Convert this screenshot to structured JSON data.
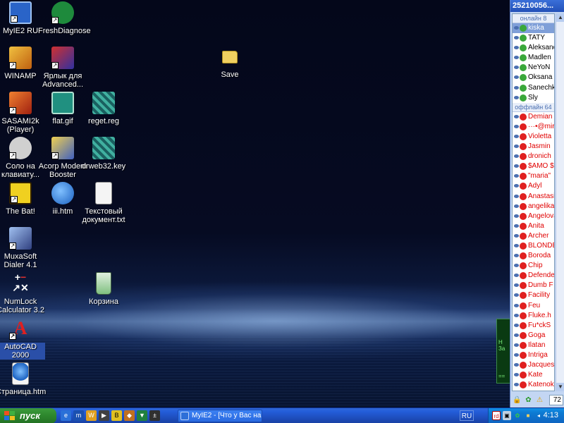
{
  "desktop": {
    "icons": [
      {
        "label": "MyIE2 RU",
        "icon": "myie2-icon",
        "color": "#2a64c8"
      },
      {
        "label": "FreshDiagnose",
        "icon": "freshdiagnose-icon",
        "color": "#2aa04a"
      },
      {
        "label": "WINAMP",
        "icon": "winamp-icon",
        "color": "#e0a020"
      },
      {
        "label": "Ярлык для Advanced...",
        "icon": "advanced-shortcut-icon",
        "color": "#c03030"
      },
      {
        "label": "Save",
        "icon": "folder-icon",
        "color": "#f0d060"
      },
      {
        "label": "SASAMI2k (Player)",
        "icon": "sasami-player-icon",
        "color": "#e06020"
      },
      {
        "label": "flat.gif",
        "icon": "gif-image-icon",
        "color": "#30a0a0"
      },
      {
        "label": "reget.reg",
        "icon": "registry-file-icon",
        "color": "#40b0a0"
      },
      {
        "label": "Соло на клавиату...",
        "icon": "solo-keyboard-icon",
        "color": "#c0c0c0"
      },
      {
        "label": "Acorp Modem Booster",
        "icon": "modem-booster-icon",
        "color": "#e0c040"
      },
      {
        "label": "drweb32.key",
        "icon": "key-file-icon",
        "color": "#40b0a0"
      },
      {
        "label": "The Bat!",
        "icon": "the-bat-icon",
        "color": "#f0d020"
      },
      {
        "label": "iii.htm",
        "icon": "html-file-icon",
        "color": "#3080e0"
      },
      {
        "label": "Текстовый документ.txt",
        "icon": "text-file-icon",
        "color": "#e0e0e0"
      },
      {
        "label": "MuxaSoft Dialer 4.1",
        "icon": "dialer-icon",
        "color": "#80a0e0"
      },
      {
        "label": "NumLock Calculator 3.2",
        "icon": "calculator-icon",
        "color": "#e04040"
      },
      {
        "label": "Корзина",
        "icon": "recycle-bin-icon",
        "color": "#60c060"
      },
      {
        "label": "AutoCAD 2000",
        "icon": "autocad-icon",
        "color": "#d02020"
      },
      {
        "label": "Страница.htm",
        "icon": "html-page-icon",
        "color": "#3080e0"
      }
    ]
  },
  "contact_list": {
    "title": "25210056...",
    "online_group": "онлайн 8",
    "offline_group": "оффлайн 64",
    "online": [
      "kiska",
      "TATY",
      "Aleksandr",
      "Madlen",
      "NeYoN",
      "Oksana",
      "Sanechka",
      "Sly"
    ],
    "offline": [
      "Demian",
      "···•@mir",
      "Violetta",
      "Jasmin",
      "dronich",
      "$AMO $",
      "\"maria\"",
      "Adyl",
      "Anastasia",
      "angelika",
      "Angelova",
      "Anita",
      "Archer",
      "BLONDE",
      "Boroda",
      "Chip",
      "Defender",
      "Dumb F",
      "Facility",
      "Feu",
      "Fluke.h",
      "Fu*ckS",
      "Goga",
      "Ilatan",
      "Intriga",
      "Jacques",
      "Kate",
      "Katenok"
    ],
    "count": "72",
    "colors": {
      "online_flower": "#3aa83a",
      "offline_flower": "#e02020",
      "selected": "#7f9fd8"
    }
  },
  "taskbar": {
    "start_label": "пуск",
    "task_label": "MyIE2 - [Что у Вас на...",
    "language": "RU",
    "clock": "4:13",
    "quick_launch": [
      "ie-icon",
      "myie2-icon",
      "winamp-icon",
      "media-icon",
      "the-bat-icon",
      "acorp-icon",
      "shield-icon",
      "numlock-icon"
    ]
  }
}
